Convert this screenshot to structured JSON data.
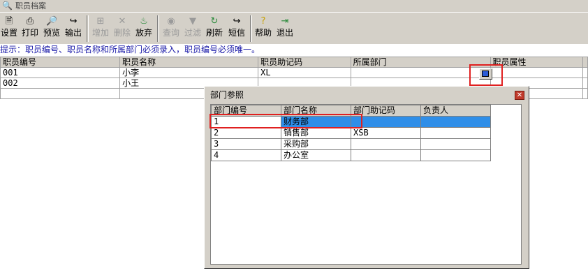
{
  "window": {
    "title": "职员档案"
  },
  "toolbar": {
    "buttons": [
      {
        "label": "设置",
        "icon": "settings-icon"
      },
      {
        "label": "打印",
        "icon": "printer-icon"
      },
      {
        "label": "预览",
        "icon": "preview-icon"
      },
      {
        "label": "输出",
        "icon": "export-icon"
      },
      {
        "label": "增加",
        "icon": "add-icon",
        "disabled": true
      },
      {
        "label": "删除",
        "icon": "delete-icon",
        "disabled": true
      },
      {
        "label": "放弃",
        "icon": "discard-icon"
      },
      {
        "label": "查询",
        "icon": "binoculars-icon",
        "disabled": true
      },
      {
        "label": "过滤",
        "icon": "filter-icon",
        "disabled": true
      },
      {
        "label": "刷新",
        "icon": "refresh-icon"
      },
      {
        "label": "短信",
        "icon": "sms-icon"
      },
      {
        "label": "帮助",
        "icon": "help-icon"
      },
      {
        "label": "退出",
        "icon": "exit-icon"
      }
    ]
  },
  "hint": "提示：职员编号、职员名称和所属部门必须录入，职员编号必须唯一。",
  "employee_grid": {
    "columns": [
      "职员编号",
      "职员名称",
      "职员助记码",
      "所属部门",
      "职员属性"
    ],
    "rows": [
      [
        "001",
        "小李",
        "XL",
        "",
        ""
      ],
      [
        "002",
        "小王",
        "",
        "",
        ""
      ]
    ]
  },
  "dept_dialog": {
    "title": "部门参照",
    "columns": [
      "部门编号",
      "部门名称",
      "部门助记码",
      "负责人"
    ],
    "rows": [
      [
        "1",
        "财务部",
        "",
        ""
      ],
      [
        "2",
        "销售部",
        "XSB",
        ""
      ],
      [
        "3",
        "采购部",
        "",
        ""
      ],
      [
        "4",
        "办公室",
        "",
        ""
      ]
    ],
    "selected_row": 0
  },
  "colors": {
    "highlight": "#2f8ee8",
    "annotation": "#e02020",
    "hint_text": "#1a1aa8"
  }
}
